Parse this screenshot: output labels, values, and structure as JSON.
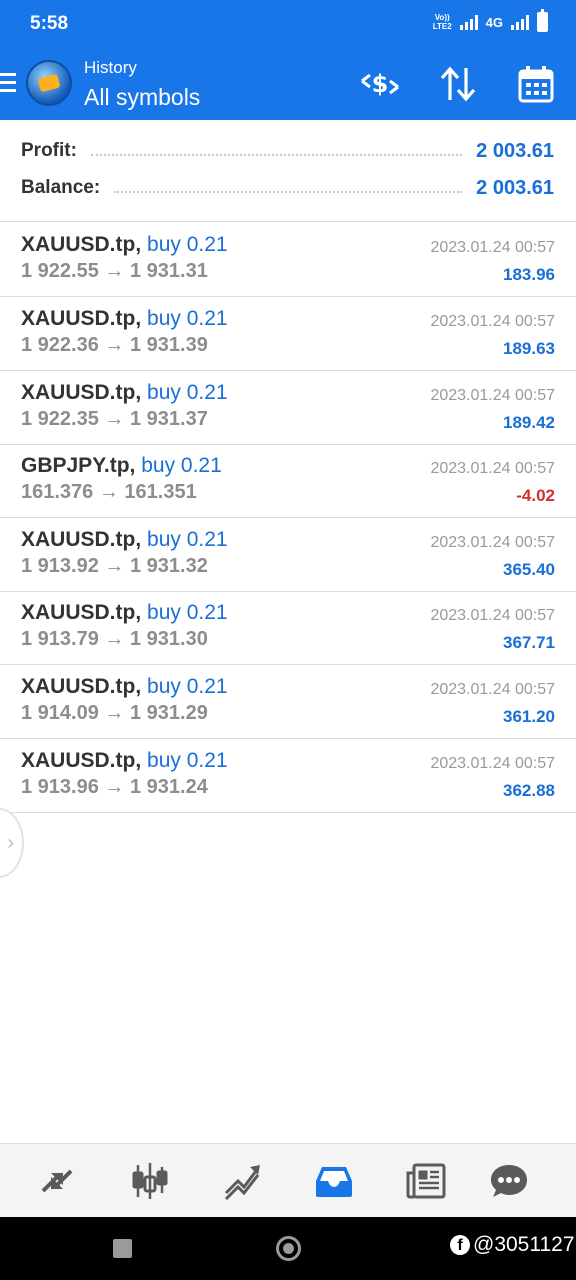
{
  "status_bar": {
    "time": "5:58",
    "volte_line1": "Vo))",
    "volte_line2": "LTE2",
    "network": "4G"
  },
  "app_bar": {
    "subtitle": "History",
    "title": "All symbols",
    "icons": [
      "menu-icon",
      "app-logo",
      "currency-exchange-icon",
      "sort-icon",
      "calendar-icon"
    ]
  },
  "summary": {
    "profit_label": "Profit:",
    "profit_value": "2 003.61",
    "balance_label": "Balance:",
    "balance_value": "2 003.61"
  },
  "deals": [
    {
      "symbol": "XAUUSD.tp,",
      "type": "buy 0.21",
      "open": "1 922.55",
      "close": "1 931.31",
      "time": "2023.01.24 00:57",
      "profit": "183.96",
      "profit_color": "#1a6fd6"
    },
    {
      "symbol": "XAUUSD.tp,",
      "type": "buy 0.21",
      "open": "1 922.36",
      "close": "1 931.39",
      "time": "2023.01.24 00:57",
      "profit": "189.63",
      "profit_color": "#1a6fd6"
    },
    {
      "symbol": "XAUUSD.tp,",
      "type": "buy 0.21",
      "open": "1 922.35",
      "close": "1 931.37",
      "time": "2023.01.24 00:57",
      "profit": "189.42",
      "profit_color": "#1a6fd6"
    },
    {
      "symbol": "GBPJPY.tp,",
      "type": "buy 0.21",
      "open": "161.376",
      "close": "161.351",
      "time": "2023.01.24 00:57",
      "profit": "-4.02",
      "profit_color": "#d32f2f"
    },
    {
      "symbol": "XAUUSD.tp,",
      "type": "buy 0.21",
      "open": "1 913.92",
      "close": "1 931.32",
      "time": "2023.01.24 00:57",
      "profit": "365.40",
      "profit_color": "#1a6fd6"
    },
    {
      "symbol": "XAUUSD.tp,",
      "type": "buy 0.21",
      "open": "1 913.79",
      "close": "1 931.30",
      "time": "2023.01.24 00:57",
      "profit": "367.71",
      "profit_color": "#1a6fd6"
    },
    {
      "symbol": "XAUUSD.tp,",
      "type": "buy 0.21",
      "open": "1 914.09",
      "close": "1 931.29",
      "time": "2023.01.24 00:57",
      "profit": "361.20",
      "profit_color": "#1a6fd6"
    },
    {
      "symbol": "XAUUSD.tp,",
      "type": "buy 0.21",
      "open": "1 913.96",
      "close": "1 931.24",
      "time": "2023.01.24 00:57",
      "profit": "362.88",
      "profit_color": "#1a6fd6"
    }
  ],
  "arrow": "→",
  "bottom_nav": {
    "items": [
      "quotes-icon",
      "chart-icon",
      "trade-icon",
      "history-icon",
      "news-icon",
      "chat-icon"
    ],
    "active": "history-icon",
    "active_color": "#1976e8",
    "inactive_color": "#5a5a5a"
  },
  "watermark": {
    "fb": "f",
    "text": "@3051127"
  },
  "colors": {
    "brand": "#1976e8",
    "positive": "#1a6fd6",
    "negative": "#d32f2f"
  }
}
